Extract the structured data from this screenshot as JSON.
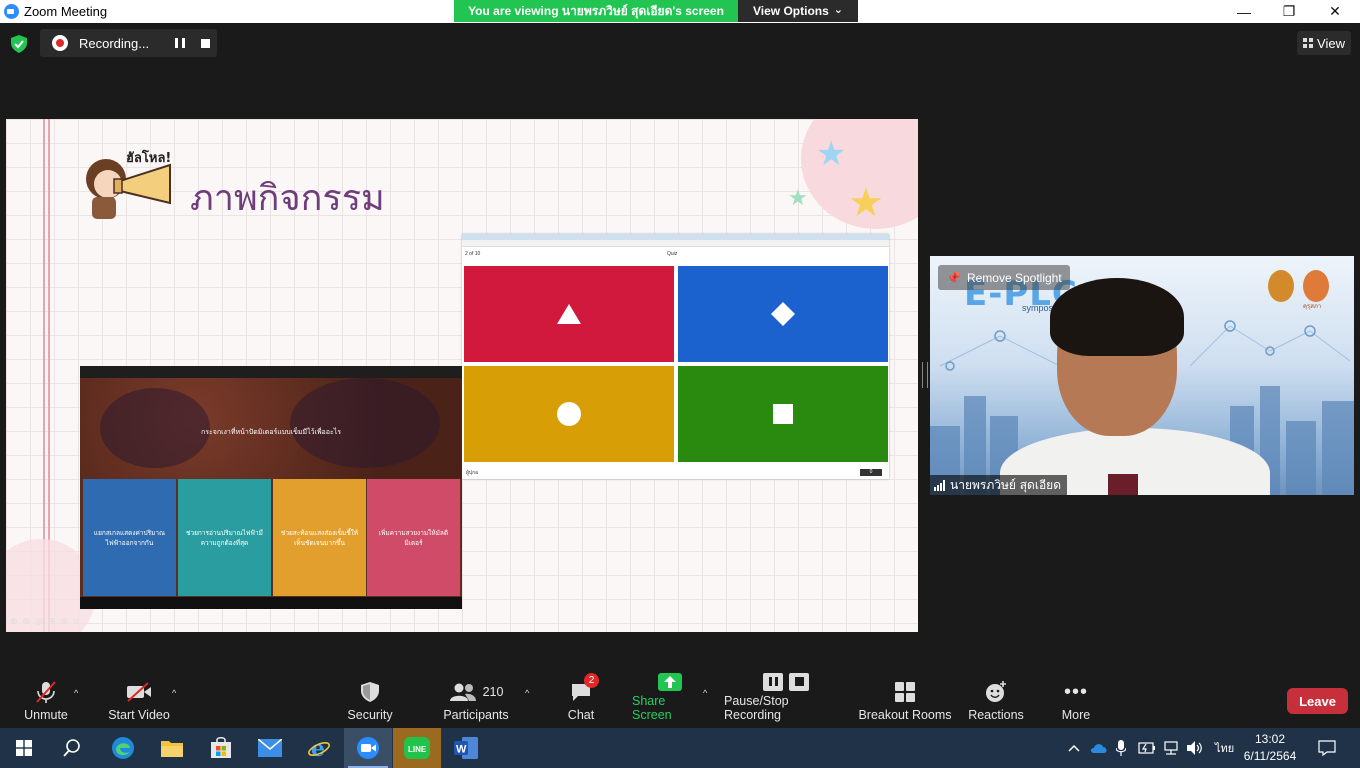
{
  "window": {
    "title": "Zoom Meeting",
    "minimize": "—",
    "restore": "❐",
    "close": "✕"
  },
  "banner": {
    "viewing_text": "You are viewing นายพรภวิษย์ สุดเอียด's screen",
    "view_options": "View Options",
    "view_options_caret": "⌄"
  },
  "topbar": {
    "recording_label": "Recording...",
    "view_label": "View"
  },
  "slide": {
    "hello": "ฮัลโหล!",
    "heading": "ภาพกิจกรรม",
    "controls": "⊕⊖◎⊞⊛○"
  },
  "quiz_right": {
    "progress": "2 of 10",
    "center_label": "Quiz",
    "footer_left": "ผู้ปุกอ",
    "score": "0",
    "tiles": [
      {
        "color": "#d0193c",
        "shape": "triangle"
      },
      {
        "color": "#1c62cf",
        "shape": "diamond"
      },
      {
        "color": "#d89e06",
        "shape": "circle"
      },
      {
        "color": "#2a8a10",
        "shape": "square"
      }
    ]
  },
  "quiz_left": {
    "question": "กระจกเงาที่หน้าปัดมิเตอร์แบบเข็มมีไว้เพื่ออะไร",
    "answers": [
      {
        "text": "แยกสเกลแสดงค่าปริมาณไฟฟ้าออกจากกัน",
        "color": "#2f6bb0"
      },
      {
        "text": "ช่วยการอ่านปริมาณไฟฟ้ามีความถูกต้องที่สุด",
        "color": "#2a9da0"
      },
      {
        "text": "ช่วยสะท้อนแสงส่องเข็มชี้ให้เห็นชัดเจนมากขึ้น",
        "color": "#e39f2e"
      },
      {
        "text": "เพิ่มความสวยงามให้มัลติมิเตอร์",
        "color": "#cf4b67"
      }
    ]
  },
  "video": {
    "remove_spotlight": "Remove Spotlight",
    "participant_name": "นายพรภวิษย์ สุดเอียด",
    "bg_logo": "E-PLC",
    "bg_sub": "symposium",
    "seal_label": "คุรุสภา"
  },
  "toolbar": {
    "unmute": "Unmute",
    "start_video": "Start Video",
    "security": "Security",
    "participants": "Participants",
    "participants_count": "210",
    "chat": "Chat",
    "chat_badge": "2",
    "share_screen": "Share Screen",
    "pause_stop_recording": "Pause/Stop Recording",
    "breakout_rooms": "Breakout Rooms",
    "reactions": "Reactions",
    "more": "More",
    "leave": "Leave",
    "caret": "^"
  },
  "taskbar": {
    "language": "ไทย",
    "time": "13:02",
    "date": "6/11/2564"
  },
  "colors": {
    "zoom_green": "#23c552",
    "leave_red": "#c7303a",
    "heading_purple": "#6e3e7c"
  }
}
